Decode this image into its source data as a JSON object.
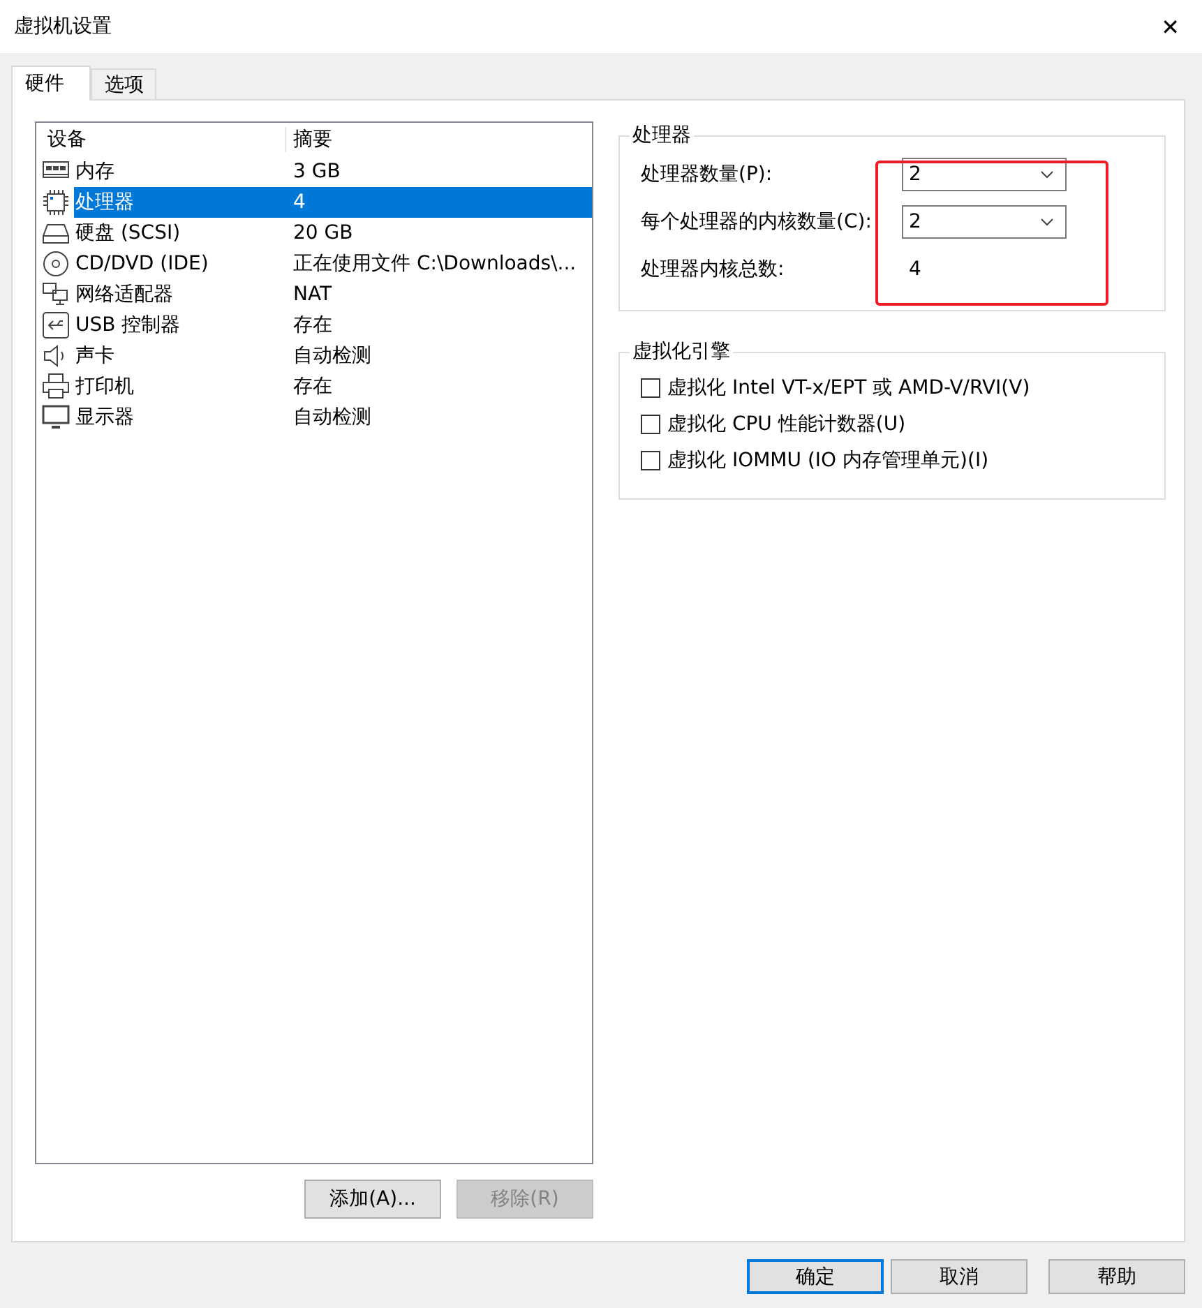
{
  "window": {
    "title": "虚拟机设置",
    "close": "✕"
  },
  "tabs": [
    {
      "label": "硬件",
      "selected": true
    },
    {
      "label": "选项",
      "selected": false
    }
  ],
  "device_list": {
    "columns": [
      "设备",
      "摘要"
    ],
    "rows": [
      {
        "kind": "memory",
        "device": "内存",
        "summary": "3 GB",
        "selected": false
      },
      {
        "kind": "cpu",
        "device": "处理器",
        "summary": "4",
        "selected": true
      },
      {
        "kind": "disk",
        "device": "硬盘 (SCSI)",
        "summary": "20 GB",
        "selected": false
      },
      {
        "kind": "cd",
        "device": "CD/DVD (IDE)",
        "summary": "正在使用文件 C:\\Downloads\\...",
        "selected": false
      },
      {
        "kind": "network",
        "device": "网络适配器",
        "summary": "NAT",
        "selected": false
      },
      {
        "kind": "usb",
        "device": "USB 控制器",
        "summary": "存在",
        "selected": false
      },
      {
        "kind": "sound",
        "device": "声卡",
        "summary": "自动检测",
        "selected": false
      },
      {
        "kind": "printer",
        "device": "打印机",
        "summary": "存在",
        "selected": false
      },
      {
        "kind": "display",
        "device": "显示器",
        "summary": "自动检测",
        "selected": false
      }
    ]
  },
  "list_buttons": [
    {
      "label": "添加(A)...",
      "disabled": false
    },
    {
      "label": "移除(R)",
      "disabled": true
    }
  ],
  "processor_group": {
    "title": "处理器",
    "fields": [
      {
        "kind": "dropdown",
        "label": "处理器数量(P):",
        "value": "2"
      },
      {
        "kind": "dropdown",
        "label": "每个处理器的内核数量(C):",
        "value": "2"
      },
      {
        "kind": "readout",
        "label": "处理器内核总数:",
        "value": "4"
      }
    ]
  },
  "virtualization_group": {
    "title": "虚拟化引擎",
    "options": [
      {
        "label": "虚拟化 Intel VT-x/EPT 或 AMD-V/RVI(V)",
        "checked": false
      },
      {
        "label": "虚拟化 CPU 性能计数器(U)",
        "checked": false
      },
      {
        "label": "虚拟化 IOMMU (IO 内存管理单元)(I)",
        "checked": false
      }
    ]
  },
  "dialog_buttons": [
    {
      "label": "确定",
      "default": true
    },
    {
      "label": "取消",
      "default": false
    },
    {
      "label": "帮助",
      "default": false
    }
  ]
}
